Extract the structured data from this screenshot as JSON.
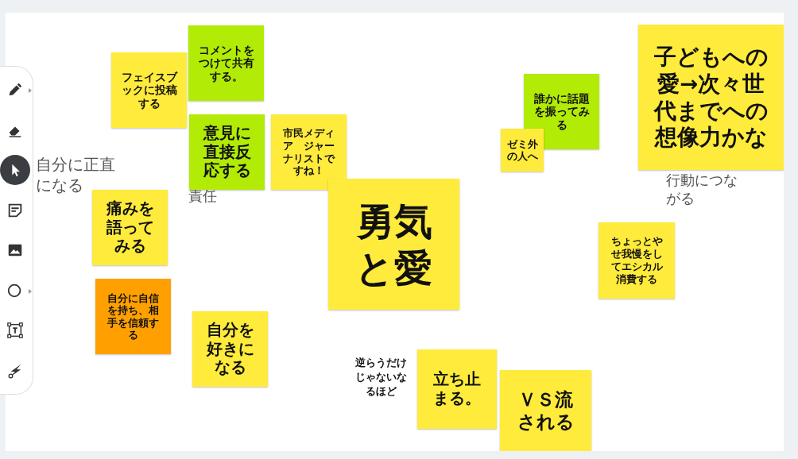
{
  "toolbar": {
    "tools": [
      {
        "selected": false,
        "submenu": true
      },
      {
        "selected": false,
        "submenu": false
      },
      {
        "selected": true,
        "submenu": false
      },
      {
        "selected": false,
        "submenu": false
      },
      {
        "selected": false,
        "submenu": false
      },
      {
        "selected": false,
        "submenu": true
      },
      {
        "selected": false,
        "submenu": false
      },
      {
        "selected": false,
        "submenu": false
      }
    ]
  },
  "canvas": {
    "notes": [
      {
        "text": "フェイスブックに投稿する",
        "color": "#ffeb3b"
      },
      {
        "text": "コメントをつけて共有する。",
        "color": "#b2eb05"
      },
      {
        "text": "意見に直接反応する",
        "color": "#b2eb05"
      },
      {
        "text": "市民メディア　ジャーナリストですね！",
        "color": "#ffeb3b"
      },
      {
        "text": "痛みを語ってみる",
        "color": "#ffeb3b"
      },
      {
        "text": "自分に自信を持ち、相手を信頼する",
        "color": "#ffa000"
      },
      {
        "text": "自分を好きになる",
        "color": "#ffeb3b"
      },
      {
        "text": "勇気と愛",
        "color": "#ffeb3b"
      },
      {
        "text": "誰かに話題を振ってみる",
        "color": "#b2eb05"
      },
      {
        "text": "ゼミ外の人へ",
        "color": "#ffeb3b"
      },
      {
        "text": "子どもへの愛→次々世代までへの想像力かな",
        "color": "#ffeb3b"
      },
      {
        "text": "ちょっとやせ我慢をしてエシカル消費する",
        "color": "#ffeb3b"
      },
      {
        "text": "立ち止まる。",
        "color": "#ffeb3b"
      },
      {
        "text": "ＶＳ流される",
        "color": "#ffeb3b"
      }
    ],
    "labels": [
      {
        "text": "自分に正直になる",
        "kind": "plain"
      },
      {
        "text": "責任",
        "kind": "plain"
      },
      {
        "text": "行動につながる",
        "kind": "plain"
      },
      {
        "text": "逆らうだけじゃないなるほど",
        "kind": "bold"
      }
    ]
  }
}
